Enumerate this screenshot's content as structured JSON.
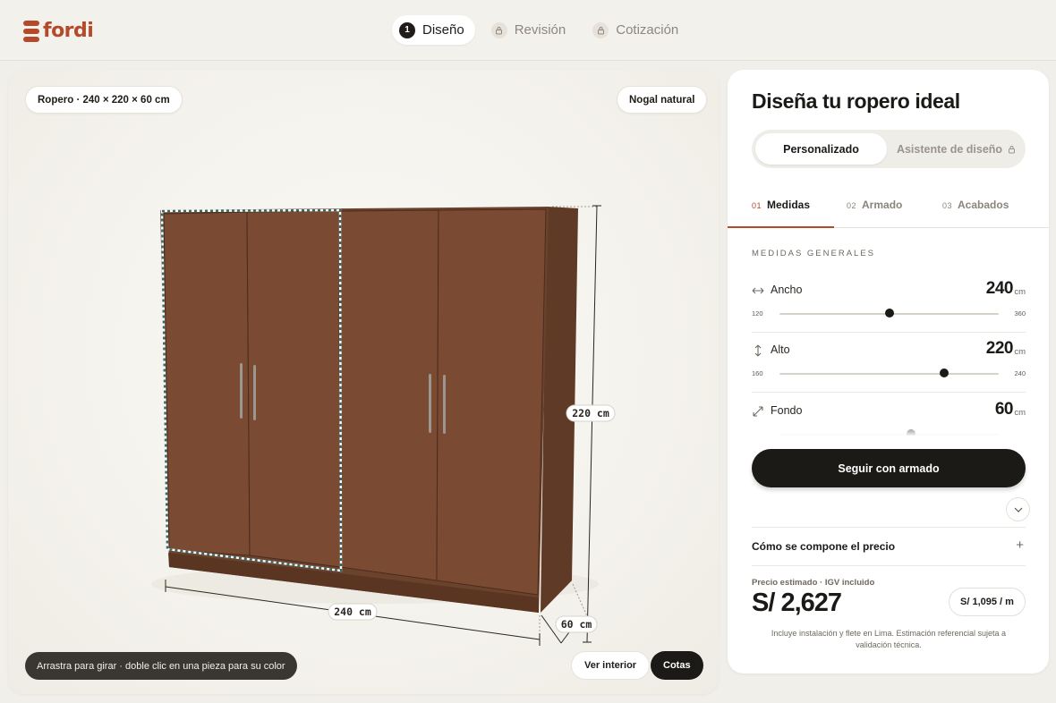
{
  "brand": {
    "name": "fordi",
    "color": "#b44a2a"
  },
  "steps": [
    {
      "number": "1",
      "label": "Diseño",
      "active": true
    },
    {
      "label": "Revisión",
      "icon": "lock-icon"
    },
    {
      "label": "Cotización",
      "icon": "lock-icon"
    }
  ],
  "viewer": {
    "product_summary": "Ropero · 240 × 220 × 60 cm",
    "finish": "Nogal natural",
    "dimension_labels": {
      "height": "220 cm",
      "width": "240 cm",
      "depth": "60 cm"
    },
    "hint": "Arrastra para girar · doble clic en una pieza para su color",
    "view_interior": "Ver interior",
    "cotas": "Cotas",
    "wood_color": "#7a4a32"
  },
  "panel": {
    "title": "Diseña tu ropero ideal",
    "modes": {
      "custom": "Personalizado",
      "assistant": "Asistente de diseño"
    },
    "tabs": [
      {
        "num": "01",
        "label": "Medidas",
        "active": true
      },
      {
        "num": "02",
        "label": "Armado"
      },
      {
        "num": "03",
        "label": "Acabados"
      }
    ],
    "section_label": "MEDIDAS GENERALES",
    "dimensions": [
      {
        "label": "Ancho",
        "value": "240",
        "unit": "cm",
        "min": "120",
        "max": "360",
        "icon": "horizontal-arrows-icon"
      },
      {
        "label": "Alto",
        "value": "220",
        "unit": "cm",
        "min": "160",
        "max": "240",
        "icon": "vertical-arrows-icon"
      },
      {
        "label": "Fondo",
        "value": "60",
        "unit": "cm",
        "icon": "diagonal-arrows-icon"
      }
    ],
    "cta": "Seguir con armado",
    "price_breakdown_label": "Cómo se compone el precio",
    "price_caption": "Precio estimado · IGV incluido",
    "price": "S/ 2,627",
    "price_per_meter": "S/ 1,095 / m",
    "note": "Incluye instalación y flete en Lima. Estimación referencial sujeta a validación técnica."
  }
}
